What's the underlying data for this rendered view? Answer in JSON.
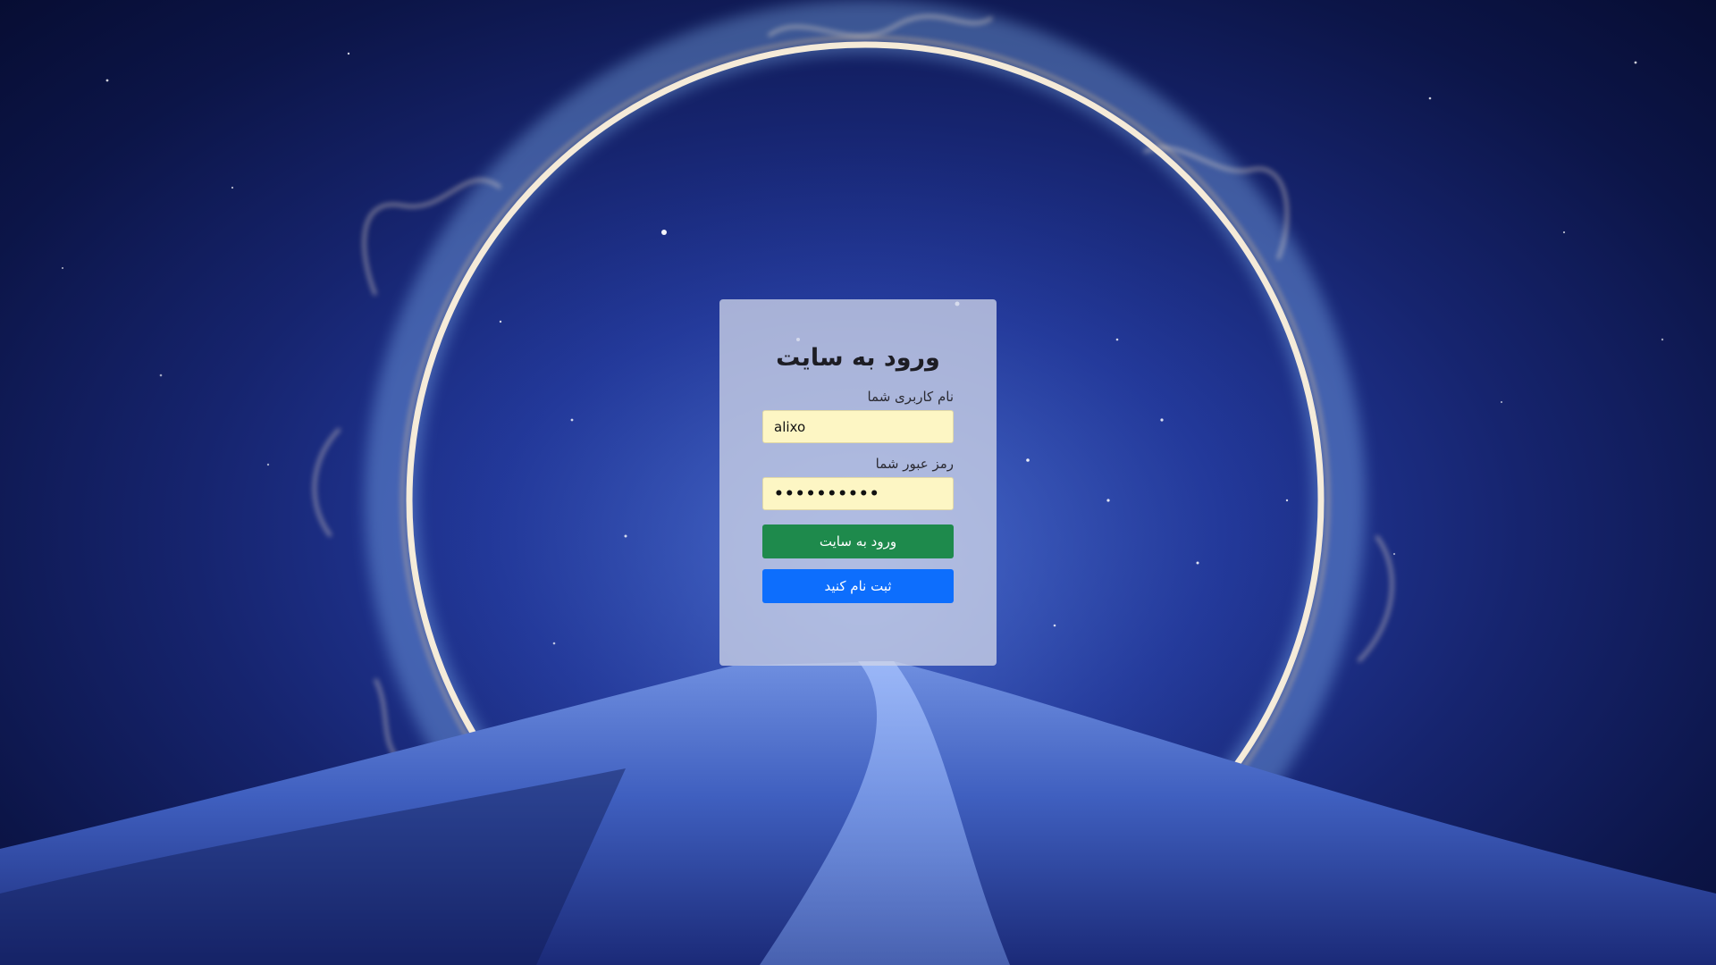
{
  "login": {
    "title": "ورود به سایت",
    "username_label": "نام کاربری شما",
    "username_value": "alixo",
    "password_label": "رمز عبور شما",
    "password_value": "••••••••••",
    "login_button": "ورود به سایت",
    "register_button": "ثبت نام کنید"
  },
  "colors": {
    "login_button": "#1e8a4c",
    "register_button": "#0d6efd",
    "input_background": "#fdf6c4",
    "card_background": "#cdd4e8"
  }
}
